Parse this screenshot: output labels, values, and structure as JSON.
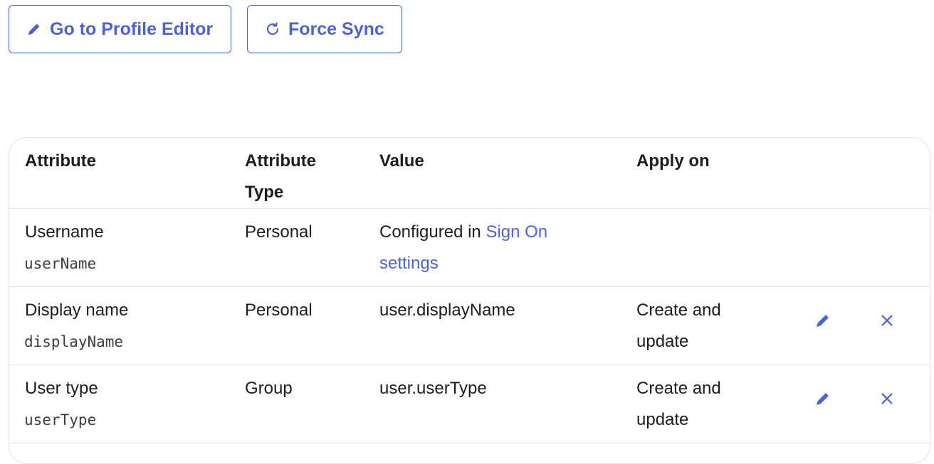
{
  "toolbar": {
    "edit_profile_label": "Go to Profile Editor",
    "force_sync_label": "Force Sync"
  },
  "colors": {
    "accent": "#4e62d8",
    "border": "#e1e1e6",
    "text": "#1d1d21"
  },
  "table": {
    "headers": {
      "attribute": "Attribute",
      "attribute_type": "Attribute Type",
      "value": "Value",
      "apply_on": "Apply on"
    },
    "rows": [
      {
        "name": "Username",
        "variable": "userName",
        "type": "Personal",
        "value_prefix": "Configured in ",
        "value_link": "Sign On settings",
        "apply_on": "",
        "editable": false
      },
      {
        "name": "Display name",
        "variable": "displayName",
        "type": "Personal",
        "value": "user.displayName",
        "apply_on": "Create and update",
        "editable": true,
        "edit_icon": "pencil-icon",
        "delete_icon": "close-icon"
      },
      {
        "name": "User type",
        "variable": "userType",
        "type": "Group",
        "value": "user.userType",
        "apply_on": "Create and update",
        "editable": true,
        "edit_icon": "pencil-icon",
        "delete_icon": "close-icon"
      }
    ]
  }
}
